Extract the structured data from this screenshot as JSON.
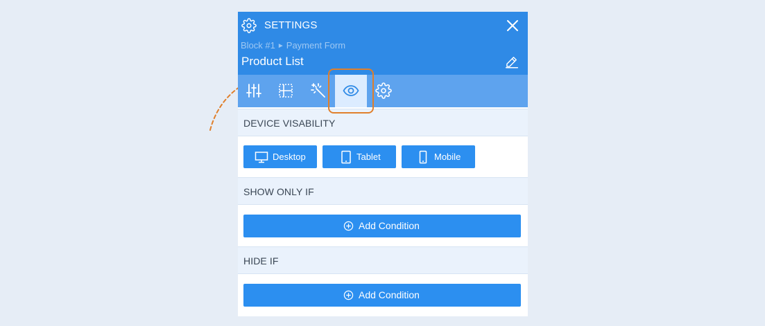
{
  "header": {
    "title": "SETTINGS",
    "breadcrumb": {
      "parent": "Block #1",
      "separator": "►",
      "current": "Payment Form"
    },
    "block_title": "Product List",
    "icons": {
      "settings": "gear-icon",
      "close": "close-icon",
      "edit": "pencil-icon"
    }
  },
  "tabs": [
    {
      "icon": "sliders-icon",
      "active": false
    },
    {
      "icon": "layout-grid-icon",
      "active": false
    },
    {
      "icon": "magic-wand-icon",
      "active": false
    },
    {
      "icon": "eye-icon",
      "active": true
    },
    {
      "icon": "gear-icon",
      "active": false
    }
  ],
  "sections": {
    "device_visibility": {
      "title": "DEVICE VISABILITY",
      "buttons": [
        {
          "label": "Desktop",
          "icon": "desktop-icon"
        },
        {
          "label": "Tablet",
          "icon": "tablet-icon"
        },
        {
          "label": "Mobile",
          "icon": "mobile-icon"
        }
      ]
    },
    "show_only_if": {
      "title": "SHOW ONLY IF",
      "button_label": "Add Condition"
    },
    "hide_if": {
      "title": "HIDE IF",
      "button_label": "Add Condition"
    }
  },
  "colors": {
    "header": "#2f8ae6",
    "tabbar": "#5ea3ee",
    "active_tab": "#dcecff",
    "button": "#2c8ff0",
    "highlight": "#e07f2b",
    "background": "#e6edf6"
  }
}
